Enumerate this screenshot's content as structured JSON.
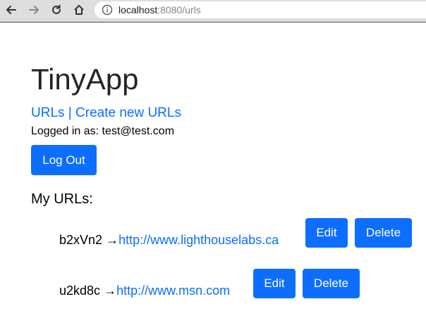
{
  "browser": {
    "url_host": "localhost",
    "url_rest": ":8080/urls"
  },
  "page": {
    "title": "TinyApp",
    "nav": {
      "urls_link": "URLs",
      "separator": "|",
      "create_link": "Create new URLs"
    },
    "logged_in_text": "Logged in as: test@test.com",
    "logout_label": "Log Out",
    "section_heading": "My URLs:"
  },
  "urls": [
    {
      "short": "b2xVn2",
      "arrow": "→",
      "long": "http://www.lighthouselabs.ca",
      "edit_label": "Edit",
      "delete_label": "Delete"
    },
    {
      "short": "u2kd8c",
      "arrow": "→",
      "long": "http://www.msn.com",
      "edit_label": "Edit",
      "delete_label": "Delete"
    }
  ],
  "colors": {
    "accent": "#0d6efd",
    "chrome_bg": "#dedede"
  },
  "icons": [
    "back-arrow-icon",
    "forward-arrow-icon",
    "reload-icon",
    "home-icon",
    "info-icon"
  ]
}
